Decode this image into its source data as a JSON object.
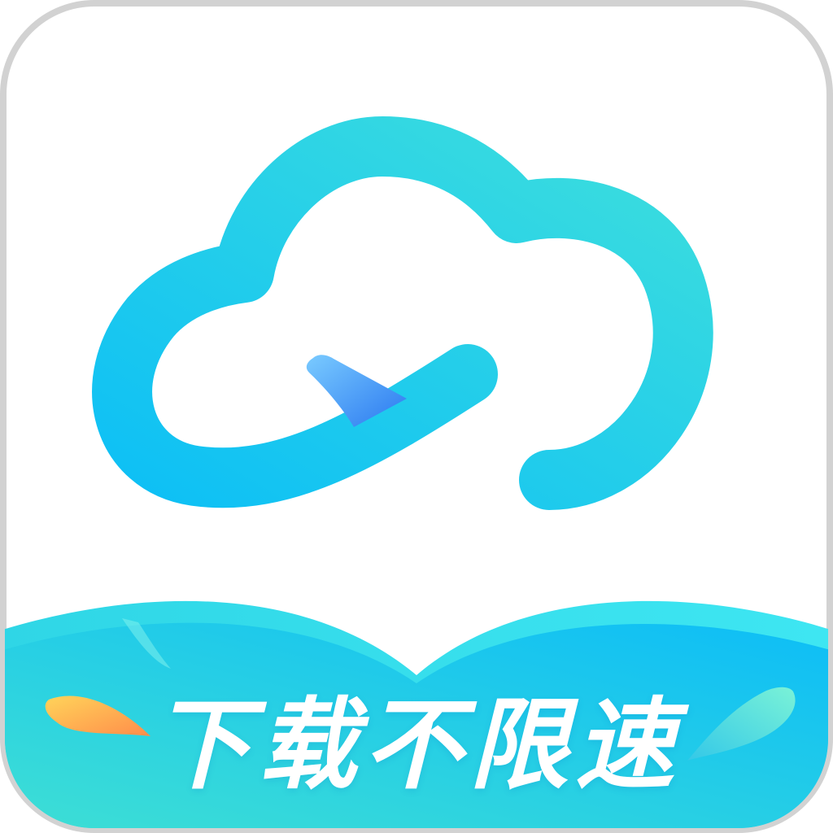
{
  "icon": {
    "slogan": "下载不限速",
    "colors": {
      "border": "#D2D2D2",
      "background": "#FFFFFF",
      "cloud_start": "#0EC0F5",
      "cloud_end": "#3DDEDD",
      "arrow_light": "#7ACBFF",
      "arrow_dark": "#2A78F0",
      "book_dark": "#16C2E6",
      "book_light": "#3EE6E8",
      "leaf_warm_start": "#FFD45A",
      "leaf_warm_end": "#FF8C4A",
      "leaf_cool_start": "#7AF2D7",
      "leaf_cool_end": "#33C8E8"
    },
    "icons": [
      "cloud-icon",
      "arrow-icon",
      "open-book-icon",
      "leaf-icon"
    ]
  }
}
